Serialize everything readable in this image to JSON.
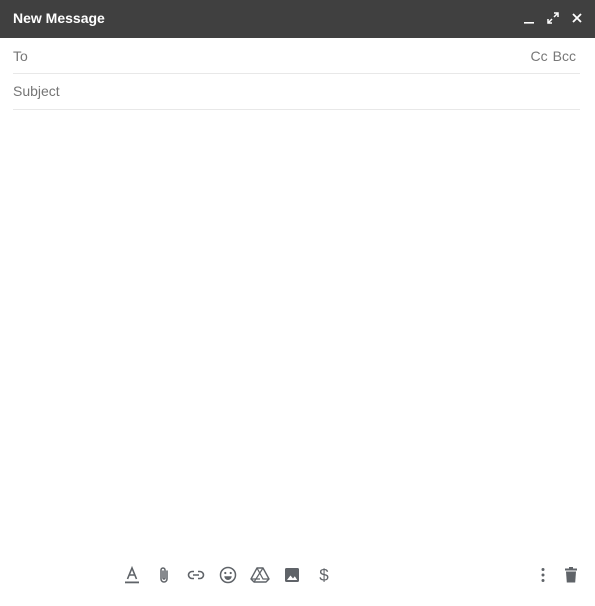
{
  "window": {
    "title": "New Message",
    "controls": [
      "minimize-icon",
      "expand-icon",
      "close-icon"
    ]
  },
  "to_field": {
    "label": "To",
    "value": "",
    "cc_label": "Cc",
    "bcc_label": "Bcc"
  },
  "subject_field": {
    "placeholder": "Subject",
    "value": ""
  },
  "body": {
    "value": ""
  },
  "toolbar": {
    "icons": [
      "formatting-options-icon",
      "attach-files-icon",
      "insert-link-icon",
      "insert-emoji-icon",
      "insert-drive-icon",
      "insert-photo-icon",
      "insert-money-icon",
      "more-options-icon",
      "discard-draft-icon"
    ]
  },
  "colors": {
    "titlebar": "#404040",
    "titlebar_text": "#ffffff",
    "label_text": "#777777",
    "divider": "#e8e8e8",
    "icon": "#5f6368"
  }
}
